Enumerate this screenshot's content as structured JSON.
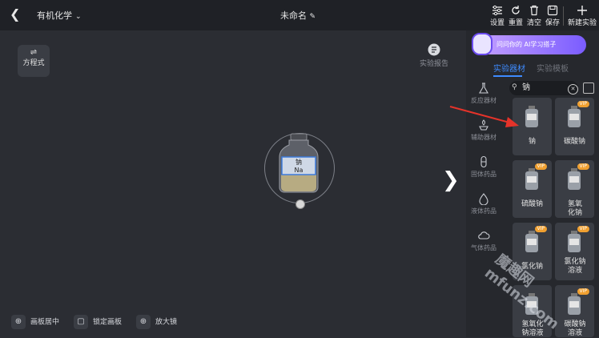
{
  "header": {
    "subject": "有机化学",
    "doc_title": "未命名",
    "tools": {
      "settings": "设置",
      "reset": "重置",
      "clear": "清空",
      "save": "保存",
      "new": "新建实验"
    }
  },
  "left": {
    "equation_label": "方程式"
  },
  "report_label": "实验报告",
  "stage": {
    "bottle_name": "钠",
    "bottle_formula": "Na"
  },
  "bottom": {
    "center": "画板居中",
    "lock": "锁定画板",
    "zoom": "放大镜"
  },
  "panel": {
    "ai_banner": "问问你的 AI学习搭子",
    "tabs": [
      "实验器材",
      "实验模板"
    ],
    "search_value": "钠",
    "categories": [
      "反应器材",
      "辅助器材",
      "固体药品",
      "液体药品",
      "气体药品"
    ],
    "items": [
      {
        "label": "钠",
        "vip": ""
      },
      {
        "label": "碳酸钠",
        "vip": "VIP"
      },
      {
        "label": "硫酸钠",
        "vip": "VIP"
      },
      {
        "label": "氢氧化钠",
        "vip": "VIP"
      },
      {
        "label": "氯化钠",
        "vip": "VIP"
      },
      {
        "label": "氯化钠溶液",
        "vip": "VIP"
      },
      {
        "label": "氢氧化钠溶液",
        "vip": ""
      },
      {
        "label": "碳酸钠溶液",
        "vip": "VIP"
      }
    ]
  },
  "watermark": "魔趣网 mfunz.com",
  "colors": {
    "accent": "#3e8bff",
    "vip": "#f0a030",
    "bg": "#2b2d33"
  }
}
